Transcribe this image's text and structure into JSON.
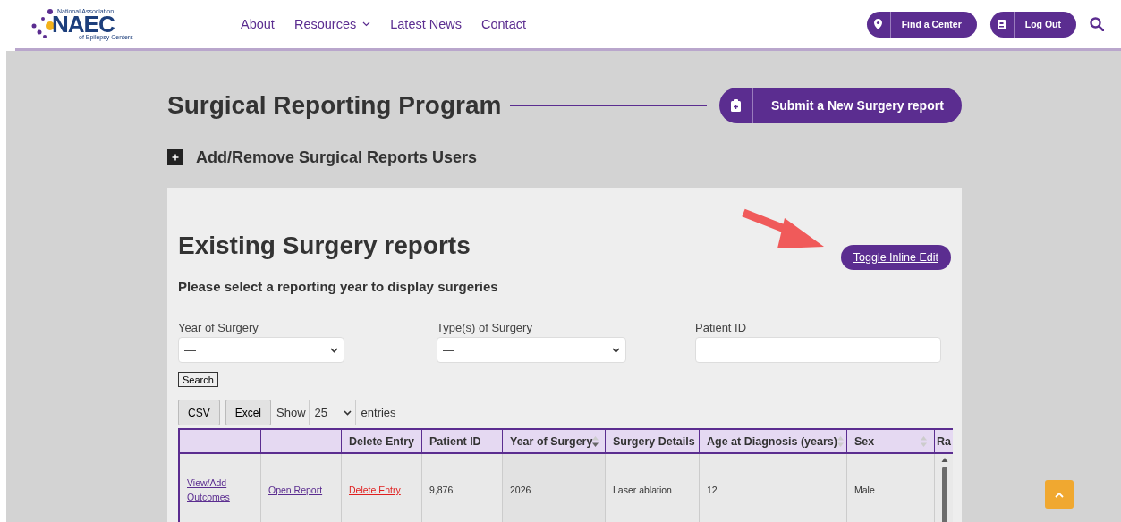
{
  "header": {
    "logo": {
      "text": "NAEC",
      "tagline_top": "National Association",
      "tagline_bottom": "of Epilepsy Centers"
    },
    "nav": [
      {
        "label": "About",
        "dropdown": false
      },
      {
        "label": "Resources",
        "dropdown": true
      },
      {
        "label": "Latest News",
        "dropdown": false
      },
      {
        "label": "Contact",
        "dropdown": false
      }
    ],
    "actions": [
      {
        "label": "Find a Center"
      },
      {
        "label": "Log Out"
      }
    ]
  },
  "page": {
    "title": "Surgical Reporting Program",
    "submit_button": "Submit a New Surgery report",
    "users_toggle": {
      "label": "Add/Remove Surgical Reports Users",
      "expanded": false
    }
  },
  "panel": {
    "title": "Existing Surgery reports",
    "toggle_button": "Toggle Inline Edit",
    "prompt": "Please select a reporting year to display surgeries",
    "filters": [
      {
        "label": "Year of Surgery",
        "kind": "select",
        "value": "—"
      },
      {
        "label": "Type(s) of Surgery",
        "kind": "select",
        "value": "—"
      },
      {
        "label": "Patient ID",
        "kind": "text"
      }
    ],
    "search_button": "Search",
    "export_buttons": [
      "CSV",
      "Excel"
    ],
    "length": {
      "before": "Show",
      "value": "25",
      "after": "entries"
    },
    "table": {
      "columns": [
        {},
        {},
        {
          "label": "Delete Entry"
        },
        {
          "label": "Patient ID"
        },
        {
          "label": "Year of Surgery",
          "sortable": true,
          "sorted": true
        },
        {
          "label": "Surgery Details"
        },
        {
          "label": "Age at Diagnosis (years)",
          "sortable": true,
          "sorted": false
        },
        {
          "label": "Sex",
          "sortable": true,
          "sorted": false
        },
        {
          "label": "Ra"
        }
      ],
      "rows": [
        {
          "cells": [
            {
              "text": "View/Add Outcomes",
              "kind": "link"
            },
            {
              "text": "Open Report",
              "kind": "link"
            },
            {
              "text": "Delete Entry",
              "kind": "danger"
            },
            {
              "text": "9,876",
              "kind": "text"
            },
            {
              "text": "2026",
              "kind": "text"
            },
            {
              "text": "Laser ablation",
              "kind": "text"
            },
            {
              "text": "12",
              "kind": "text"
            },
            {
              "text": "Male",
              "kind": "text"
            }
          ]
        }
      ]
    }
  }
}
